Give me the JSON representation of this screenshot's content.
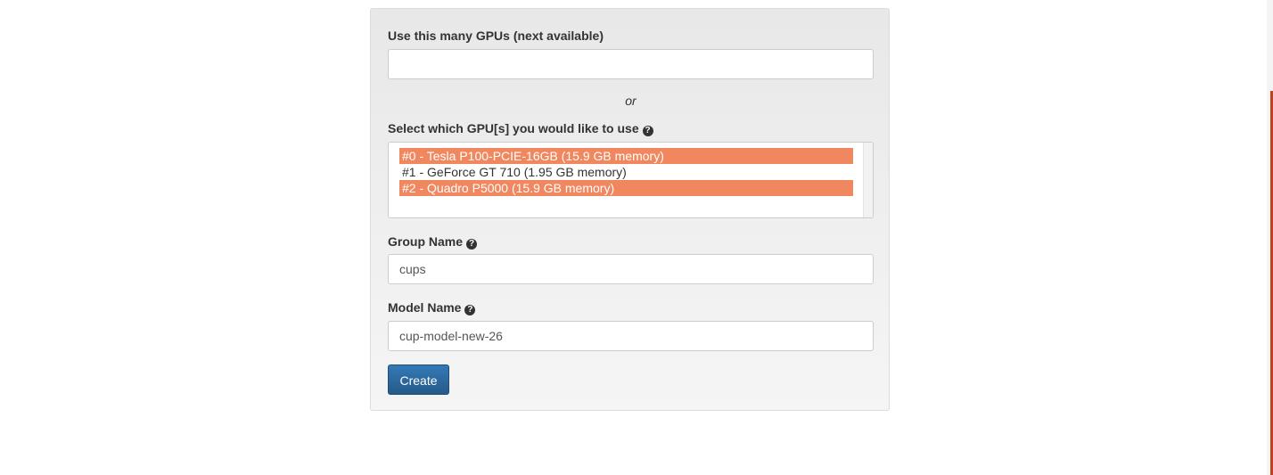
{
  "form": {
    "gpu_count_label": "Use this many GPUs (next available)",
    "gpu_count_value": "",
    "or_text": "or",
    "gpu_select_label": "Select which GPU[s] you would like to use",
    "gpu_options": [
      {
        "label": "#0 - Tesla P100-PCIE-16GB (15.9 GB memory)",
        "selected": true
      },
      {
        "label": "#1 - GeForce GT 710 (1.95 GB memory)",
        "selected": false
      },
      {
        "label": "#2 - Quadro P5000 (15.9 GB memory)",
        "selected": true
      }
    ],
    "group_name_label": "Group Name",
    "group_name_value": "cups",
    "model_name_label": "Model Name",
    "model_name_value": "cup-model-new-26",
    "create_button_label": "Create",
    "help_icon_glyph": "?"
  },
  "colors": {
    "selected_option_bg": "#f0875e",
    "primary_button": "#337ab7",
    "scrollbar_thumb": "#c0421c"
  }
}
